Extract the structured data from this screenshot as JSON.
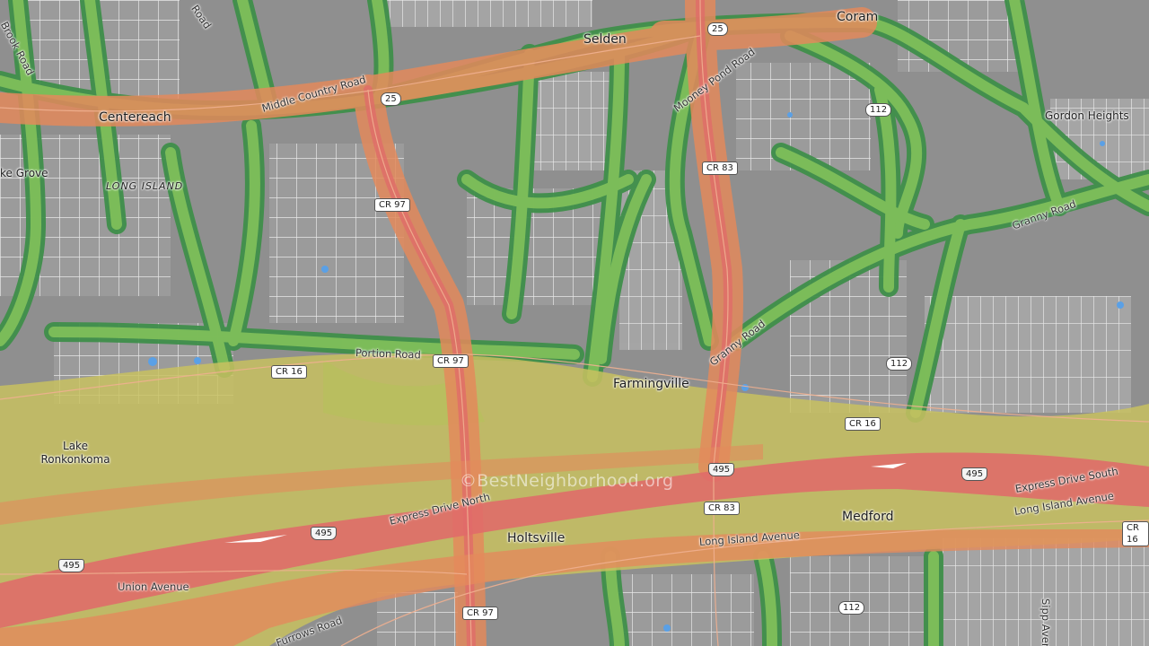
{
  "map": {
    "watermark": "©BestNeighborhood.org",
    "places": [
      {
        "id": "selden",
        "name": "Selden"
      },
      {
        "id": "coram",
        "name": "Coram"
      },
      {
        "id": "centereach",
        "name": "Centereach"
      },
      {
        "id": "gordon-heights",
        "name": "Gordon Heights"
      },
      {
        "id": "lake-grove",
        "name": "ke Grove"
      },
      {
        "id": "long-island",
        "name": "LONG ISLAND"
      },
      {
        "id": "farmingville",
        "name": "Farmingville"
      },
      {
        "id": "lake-ronkonkoma",
        "name": "Lake Ronkonkoma"
      },
      {
        "id": "holtsville",
        "name": "Holtsville"
      },
      {
        "id": "medford",
        "name": "Medford"
      }
    ],
    "roads": [
      {
        "id": "middle-country-road",
        "name": "Middle Country Road"
      },
      {
        "id": "mooney-pond-road",
        "name": "Mooney Pond Road"
      },
      {
        "id": "granny-road-1",
        "name": "Granny Road"
      },
      {
        "id": "granny-road-2",
        "name": "Granny Road"
      },
      {
        "id": "portion-road",
        "name": "Portion Road"
      },
      {
        "id": "express-drive-north",
        "name": "Express Drive North"
      },
      {
        "id": "express-drive-south",
        "name": "Express Drive South"
      },
      {
        "id": "long-island-avenue-1",
        "name": "Long Island Avenue"
      },
      {
        "id": "long-island-avenue-2",
        "name": "Long Island Avenue"
      },
      {
        "id": "union-avenue",
        "name": "Union Avenue"
      },
      {
        "id": "furrows-road",
        "name": "Furrows Road"
      },
      {
        "id": "brook-road",
        "name": "Brook Road"
      },
      {
        "id": "road-top",
        "name": "Road"
      },
      {
        "id": "sipp-avenue",
        "name": "Sipp Avenue"
      }
    ],
    "shields": [
      {
        "id": "s25a",
        "text": "25"
      },
      {
        "id": "s25b",
        "text": "25"
      },
      {
        "id": "s112a",
        "text": "112"
      },
      {
        "id": "s112b",
        "text": "112"
      },
      {
        "id": "s112c",
        "text": "112"
      },
      {
        "id": "cr83a",
        "text": "CR 83"
      },
      {
        "id": "cr83b",
        "text": "CR 83"
      },
      {
        "id": "cr97a",
        "text": "CR 97"
      },
      {
        "id": "cr97b",
        "text": "CR 97"
      },
      {
        "id": "cr97c",
        "text": "CR 97"
      },
      {
        "id": "cr16a",
        "text": "CR 16"
      },
      {
        "id": "cr16b",
        "text": "CR 16"
      },
      {
        "id": "cr16c",
        "text": "CR 16"
      },
      {
        "id": "i495a",
        "text": "495"
      },
      {
        "id": "i495b",
        "text": "495"
      },
      {
        "id": "i495c",
        "text": "495"
      },
      {
        "id": "i495d",
        "text": "495"
      }
    ],
    "colors": {
      "background": "#8f8f8f",
      "block": "#a3a3a3",
      "street": "#f2f2f2",
      "water": "#5aa0e6",
      "traffic_low": "#3f8f4a",
      "traffic_low_light": "#7fbf5a",
      "traffic_medium": "#c8c160",
      "traffic_high": "#e38a5c",
      "traffic_very_high": "#e06a6a"
    }
  }
}
